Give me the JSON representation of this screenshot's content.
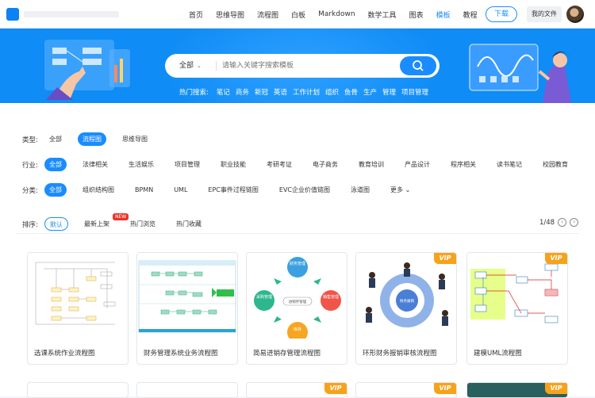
{
  "nav": {
    "items": [
      "首页",
      "思维导图",
      "流程图",
      "白板",
      "Markdown",
      "数学工具",
      "图表",
      "模板",
      "教程"
    ],
    "active": "模板",
    "download": "下载",
    "my_files": "我的文件"
  },
  "search": {
    "scope": "全部",
    "placeholder": "请输入关键字搜索模板",
    "hot_label": "热门搜索:",
    "hot": [
      "笔记",
      "商务",
      "新冠",
      "英语",
      "工作计划",
      "组织",
      "鱼骨",
      "生产",
      "管理",
      "项目管理"
    ]
  },
  "filters": {
    "type_label": "类型:",
    "types": [
      "全部",
      "流程图",
      "思维导图"
    ],
    "type_selected": "流程图",
    "industry_label": "行业:",
    "industries": [
      "全部",
      "法律相关",
      "生活娱乐",
      "项目管理",
      "职业技能",
      "考研考证",
      "电子商务",
      "教育培训",
      "产品设计",
      "程序相关",
      "读书笔记",
      "校园教育"
    ],
    "industry_selected": "全部",
    "category_label": "分类:",
    "categories": [
      "全部",
      "组织结构图",
      "BPMN",
      "UML",
      "EPC事件过程链图",
      "EVC企业价值链图",
      "泳道图",
      "更多"
    ],
    "category_selected": "全部",
    "sort_label": "排序:",
    "sorts": [
      "默认",
      "最新上架",
      "热门浏览",
      "热门收藏"
    ],
    "sort_selected": "默认",
    "new_badge": "NEW",
    "page": "1/48"
  },
  "cards": [
    {
      "title": "选课系统作业流程图",
      "vip": false
    },
    {
      "title": "财务管理系统业务流程图",
      "vip": false
    },
    {
      "title": "简易进销存管理流程图",
      "vip": false,
      "labels": [
        "财务管理",
        "采购管理",
        "进销存管理",
        "销售管理",
        "库存"
      ]
    },
    {
      "title": "环形财务报销审核流程图",
      "vip": true,
      "labels": [
        "财务报销"
      ]
    },
    {
      "title": "建模UML流程图",
      "vip": true
    }
  ],
  "vip_label": "VIP",
  "colors": {
    "primary": "#1a8cff",
    "hero": "#0f8cf5",
    "vip": "#f7a21b",
    "new": "#e8332a"
  }
}
